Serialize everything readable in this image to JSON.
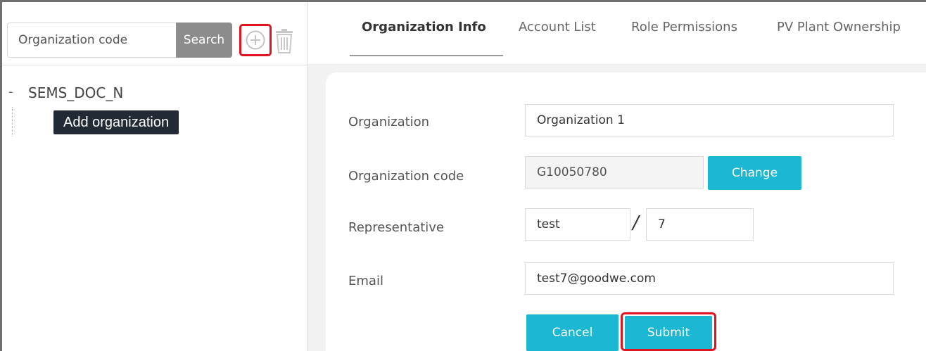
{
  "left_panel": {
    "search": {
      "placeholder": "Organization code",
      "button_label": "Search"
    },
    "tree": {
      "root_toggle": "-",
      "root_label": "SEMS_DOC_N",
      "child_label": "Add organization"
    }
  },
  "tabs": [
    {
      "label": "Organization Info",
      "active": true
    },
    {
      "label": "Account List",
      "active": false
    },
    {
      "label": "Role Permissions",
      "active": false
    },
    {
      "label": "PV Plant Ownership",
      "active": false
    }
  ],
  "form": {
    "organization": {
      "label": "Organization",
      "value": "Organization 1"
    },
    "organization_code": {
      "label": "Organization code",
      "value": "G10050780",
      "change_label": "Change"
    },
    "representative": {
      "label": "Representative",
      "name": "test",
      "separator": "/",
      "number": "7"
    },
    "email": {
      "label": "Email",
      "value": "test7@goodwe.com"
    },
    "cancel_label": "Cancel",
    "submit_label": "Submit"
  },
  "colors": {
    "accent": "#1cb7d2",
    "highlight_outline": "#e0141f",
    "search_button": "#8c8c8c",
    "tree_selected_bg": "#222b35"
  },
  "icons": {
    "add": "plus-circle-icon",
    "delete": "trash-icon"
  }
}
